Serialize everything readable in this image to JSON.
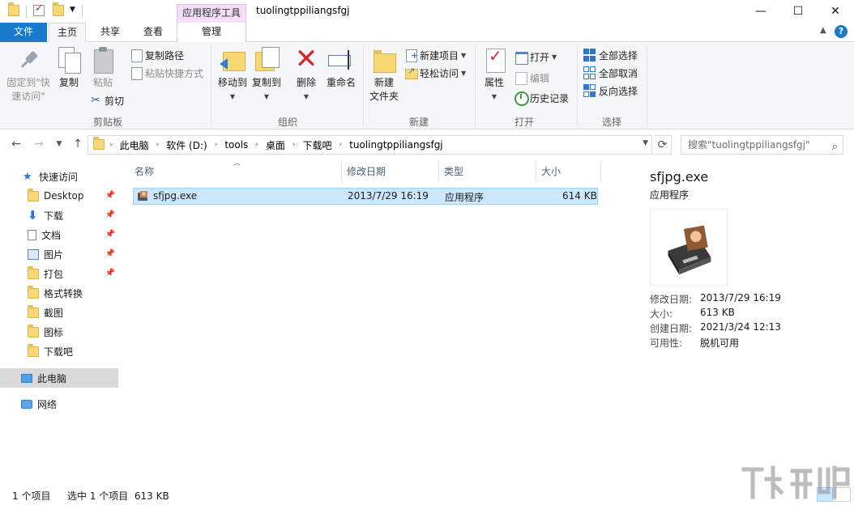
{
  "window": {
    "title": "tuolingtppiliangsfgj",
    "context_tab_group": "应用程序工具",
    "controls": {
      "minimize": "—",
      "maximize": "☐",
      "close": "✕"
    }
  },
  "ribbon_tabs": [
    {
      "label": "文件"
    },
    {
      "label": "主页"
    },
    {
      "label": "共享"
    },
    {
      "label": "查看"
    },
    {
      "label": "管理"
    }
  ],
  "ribbon": {
    "clipboard": {
      "label": "剪贴板",
      "pin_line1": "固定到\"快",
      "pin_line2": "速访问\"",
      "copy": "复制",
      "paste": "粘贴",
      "copy_path": "复制路径",
      "paste_shortcut": "粘贴快捷方式",
      "cut": "剪切"
    },
    "organize": {
      "label": "组织",
      "move_to": "移动到",
      "copy_to": "复制到",
      "delete": "删除",
      "rename": "重命名"
    },
    "new": {
      "label": "新建",
      "new_folder_line1": "新建",
      "new_folder_line2": "文件夹",
      "new_item": "新建项目",
      "easy_access": "轻松访问"
    },
    "open": {
      "label": "打开",
      "properties": "属性",
      "open": "打开",
      "edit": "编辑",
      "history": "历史记录"
    },
    "select": {
      "label": "选择",
      "select_all": "全部选择",
      "select_none": "全部取消",
      "invert": "反向选择"
    }
  },
  "address": {
    "crumbs": [
      "此电脑",
      "软件 (D:)",
      "tools",
      "桌面",
      "下载吧",
      "tuolingtppiliangsfgj"
    ],
    "search_placeholder": "搜索\"tuolingtppiliangsfgj\""
  },
  "nav_pane": {
    "quick_access": "快速访问",
    "items": [
      {
        "label": "Desktop",
        "pinned": true
      },
      {
        "label": "下载",
        "pinned": true
      },
      {
        "label": "文档",
        "pinned": true
      },
      {
        "label": "图片",
        "pinned": true
      },
      {
        "label": "打包",
        "pinned": true
      },
      {
        "label": "格式转换",
        "pinned": false
      },
      {
        "label": "截图",
        "pinned": false
      },
      {
        "label": "图标",
        "pinned": false
      },
      {
        "label": "下载吧",
        "pinned": false
      }
    ],
    "this_pc": "此电脑",
    "network": "网络"
  },
  "file_list": {
    "columns": [
      "名称",
      "修改日期",
      "类型",
      "大小"
    ],
    "rows": [
      {
        "name": "sfjpg.exe",
        "modified": "2013/7/29 16:19",
        "type": "应用程序",
        "size": "614 KB"
      }
    ]
  },
  "details": {
    "name": "sfjpg.exe",
    "type": "应用程序",
    "props": [
      {
        "key": "修改日期:",
        "value": "2013/7/29 16:19"
      },
      {
        "key": "大小:",
        "value": "613 KB"
      },
      {
        "key": "创建日期:",
        "value": "2021/3/24 12:13"
      },
      {
        "key": "可用性:",
        "value": "脱机可用"
      }
    ]
  },
  "status": {
    "item_count": "1 个项目",
    "selection": "选中 1 个项目  613 KB"
  },
  "colors": {
    "accent": "#1979ca",
    "selection": "#cce8ff",
    "context_tab": "#f3dff7"
  }
}
